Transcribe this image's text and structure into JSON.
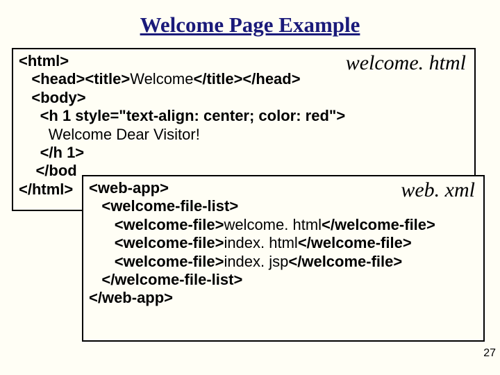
{
  "title": "Welcome Page Example",
  "box1": {
    "filename": "welcome. html",
    "lines": {
      "l0a": "<html>",
      "l1a": "<head><title>",
      "l1b": "Welcome",
      "l1c": "</title></head>",
      "l2": "<body>",
      "l3": "<h 1 style=\"text-align: center; color: red\">",
      "l4": "Welcome Dear Visitor!",
      "l5": "</h 1>",
      "l6a": "</bod",
      "l7a": "</html>"
    }
  },
  "box2": {
    "filename": "web. xml",
    "lines": {
      "l0": "<web-app>",
      "l1": "<welcome-file-list>",
      "l2a": "<welcome-file>",
      "l2b": "welcome. html",
      "l2c": "</welcome-file>",
      "l3a": "<welcome-file>",
      "l3b": "index. html",
      "l3c": "</welcome-file>",
      "l4a": "<welcome-file>",
      "l4b": "index. jsp",
      "l4c": "</welcome-file>",
      "l5": "</welcome-file-list>",
      "l6": "</web-app>"
    }
  },
  "pagenum": "27"
}
